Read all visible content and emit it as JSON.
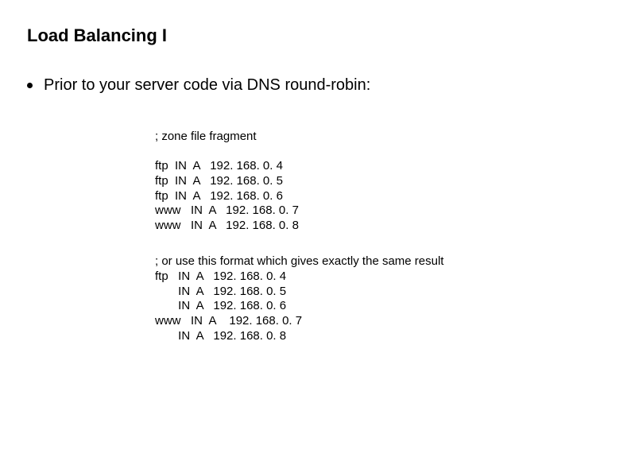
{
  "title": "Load Balancing I",
  "bullet": "Prior to your server code via DNS round-robin:",
  "comment1": "; zone file fragment",
  "records1": "ftp  IN  A   192. 168. 0. 4\nftp  IN  A   192. 168. 0. 5\nftp  IN  A   192. 168. 0. 6\nwww   IN  A   192. 168. 0. 7\nwww   IN  A   192. 168. 0. 8",
  "block2": "; or use this format which gives exactly the same result\nftp   IN  A   192. 168. 0. 4\n       IN  A   192. 168. 0. 5\n       IN  A   192. 168. 0. 6\nwww   IN  A    192. 168. 0. 7\n       IN  A   192. 168. 0. 8"
}
